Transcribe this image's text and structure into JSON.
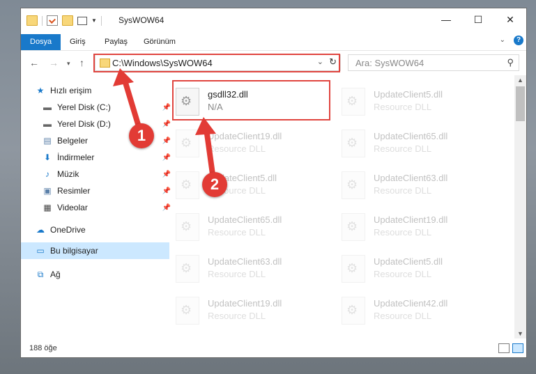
{
  "window": {
    "title": "SysWOW64",
    "minimize_icon": "minimize-icon",
    "maximize_icon": "maximize-icon",
    "close_icon": "close-icon"
  },
  "quick_access_toolbar": {
    "icons": [
      "folder-icon",
      "properties-icon",
      "new-folder-icon",
      "customize-icon"
    ]
  },
  "ribbon": {
    "tabs": [
      "Dosya",
      "Giriş",
      "Paylaş",
      "Görünüm"
    ],
    "accent": "#1979ca",
    "help_icon": "help-icon",
    "help_glyph": "?"
  },
  "navigation": {
    "back_icon": "back-arrow-icon",
    "forward_icon": "forward-arrow-icon",
    "recent_icon": "chevron-down-icon",
    "up_icon": "up-arrow-icon",
    "address": "C:\\Windows\\SysWOW64",
    "search_placeholder": "Ara: SysWOW64"
  },
  "sidebar": {
    "items": [
      {
        "label": "Hızlı erişim",
        "icon": "star-icon",
        "pinned": false
      },
      {
        "label": "Yerel Disk (C:)",
        "icon": "drive-icon",
        "pinned": true
      },
      {
        "label": "Yerel Disk (D:)",
        "icon": "drive-icon",
        "pinned": true
      },
      {
        "label": "Belgeler",
        "icon": "documents-icon",
        "pinned": true
      },
      {
        "label": "İndirmeler",
        "icon": "download-icon",
        "pinned": true
      },
      {
        "label": "Müzik",
        "icon": "music-icon",
        "pinned": true
      },
      {
        "label": "Resimler",
        "icon": "pictures-icon",
        "pinned": true
      },
      {
        "label": "Videolar",
        "icon": "videos-icon",
        "pinned": true
      },
      {
        "label": "OneDrive",
        "icon": "cloud-icon",
        "pinned": false
      },
      {
        "label": "Bu bilgisayar",
        "icon": "computer-icon",
        "pinned": false,
        "selected": true
      },
      {
        "label": "Ağ",
        "icon": "network-icon",
        "pinned": false
      }
    ]
  },
  "files": {
    "highlighted": {
      "name": "gsdll32.dll",
      "type": "N/A"
    },
    "left_column": [
      {
        "name": "UpdateClient19.dll",
        "type": "Resource DLL"
      },
      {
        "name": "UpdateClient5.dll",
        "type": "Resource DLL"
      },
      {
        "name": "UpdateClient65.dll",
        "type": "Resource DLL"
      },
      {
        "name": "UpdateClient63.dll",
        "type": "Resource DLL"
      },
      {
        "name": "UpdateClient19.dll",
        "type": "Resource DLL"
      }
    ],
    "right_column": [
      {
        "name": "UpdateClient5.dll",
        "type": "Resource DLL"
      },
      {
        "name": "UpdateClient65.dll",
        "type": "Resource DLL"
      },
      {
        "name": "UpdateClient63.dll",
        "type": "Resource DLL"
      },
      {
        "name": "UpdateClient19.dll",
        "type": "Resource DLL"
      },
      {
        "name": "UpdateClient5.dll",
        "type": "Resource DLL"
      },
      {
        "name": "UpdateClient42.dll",
        "type": "Resource DLL"
      }
    ]
  },
  "status": {
    "count": "188 öğe"
  },
  "annotations": {
    "step1": "1",
    "step2": "2",
    "color": "#e0443e"
  }
}
